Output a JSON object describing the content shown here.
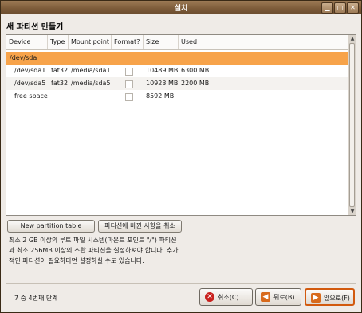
{
  "window": {
    "title": "설치"
  },
  "page_title": "새 파티션 만들기",
  "table": {
    "columns": [
      "Device",
      "Type",
      "Mount point",
      "Format?",
      "Size",
      "Used"
    ],
    "rows": [
      {
        "device": "/dev/sda",
        "type": "",
        "mount": "",
        "format": "",
        "size": "",
        "used": ""
      },
      {
        "device": "/dev/sda1",
        "type": "fat32",
        "mount": "/media/sda1",
        "format": "unchecked",
        "size": "10489 MB",
        "used": "6300 MB"
      },
      {
        "device": "/dev/sda5",
        "type": "fat32",
        "mount": "/media/sda5",
        "format": "unchecked",
        "size": "10923 MB",
        "used": "2200 MB"
      },
      {
        "device": "free space",
        "type": "",
        "mount": "",
        "format": "unchecked",
        "size": "8592 MB",
        "used": ""
      }
    ]
  },
  "buttons": {
    "new_partition_table": "New partition table",
    "undo_changes": "파티션에 바뀐 사항을 취소"
  },
  "info_lines": [
    "최소 2 GB 이상의 루트 파일 시스템(마운트 포인트 \"/\") 파티션",
    "과 최소 256MB 이상의 스왑 파티션을 설정하셔야 합니다. 추가",
    "적인 파티션이 필요하다면 설정하실 수도 있습니다."
  ],
  "step_text": "7 중 4번째 단계",
  "nav": {
    "cancel": "취소(C)",
    "back": "뒤로(B)",
    "forward": "앞으로(F)"
  },
  "colors": {
    "accent": "#f7a34a",
    "titlebar": "#7b5a38"
  }
}
